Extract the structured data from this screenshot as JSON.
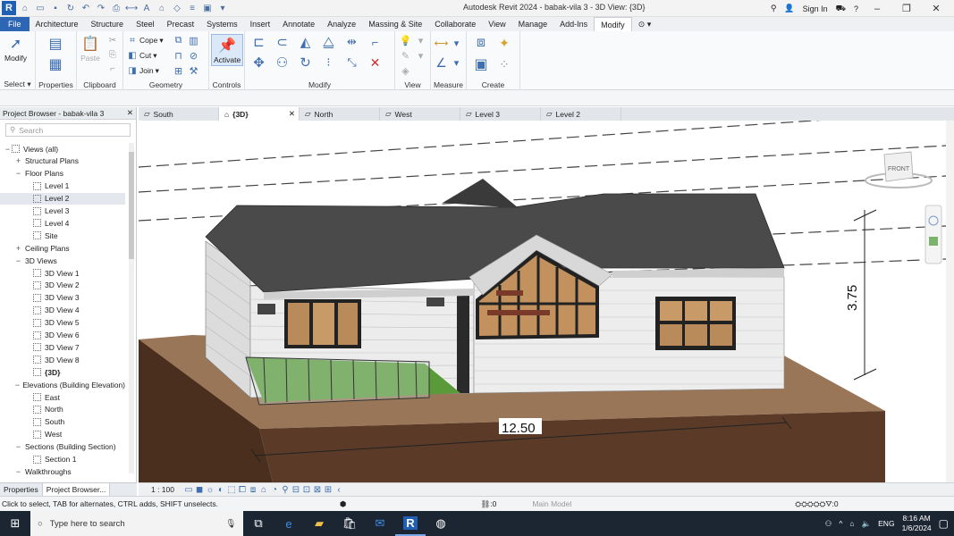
{
  "titlebar": {
    "app_title": "Autodesk Revit 2024 - babak-vila 3 - 3D View: {3D}",
    "sign_in": "Sign In",
    "help": "?"
  },
  "ribbon_tabs": [
    "File",
    "Architecture",
    "Structure",
    "Steel",
    "Precast",
    "Systems",
    "Insert",
    "Annotate",
    "Analyze",
    "Massing & Site",
    "Collaborate",
    "View",
    "Manage",
    "Add-Ins",
    "Modify"
  ],
  "active_tab": "Modify",
  "ribbon": {
    "select": {
      "modify": "Modify",
      "label": "Select ▾"
    },
    "properties": {
      "label": "Properties"
    },
    "clipboard": {
      "paste": "Paste",
      "label": "Clipboard"
    },
    "geometry": {
      "cope": "Cope",
      "cut": "Cut",
      "join": "Join",
      "label": "Geometry"
    },
    "controls": {
      "activate": "Activate",
      "label": "Controls"
    },
    "modify": {
      "label": "Modify"
    },
    "view": {
      "label": "View"
    },
    "measure": {
      "label": "Measure"
    },
    "create": {
      "label": "Create"
    }
  },
  "project_browser": {
    "title": "Project Browser - babak-vila 3",
    "search_placeholder": "Search",
    "tree": [
      {
        "label": "Views (all)",
        "level": 0,
        "toggle": "−",
        "icon": true
      },
      {
        "label": "Structural Plans",
        "level": 1,
        "toggle": "+"
      },
      {
        "label": "Floor Plans",
        "level": 1,
        "toggle": "−"
      },
      {
        "label": "Level 1",
        "level": 2,
        "icon": true
      },
      {
        "label": "Level 2",
        "level": 2,
        "icon": true,
        "selected": true
      },
      {
        "label": "Level 3",
        "level": 2,
        "icon": true
      },
      {
        "label": "Level 4",
        "level": 2,
        "icon": true
      },
      {
        "label": "Site",
        "level": 2,
        "icon": true
      },
      {
        "label": "Ceiling Plans",
        "level": 1,
        "toggle": "+"
      },
      {
        "label": "3D Views",
        "level": 1,
        "toggle": "−"
      },
      {
        "label": "3D View 1",
        "level": 2,
        "icon": true
      },
      {
        "label": "3D View 2",
        "level": 2,
        "icon": true
      },
      {
        "label": "3D View 3",
        "level": 2,
        "icon": true
      },
      {
        "label": "3D View 4",
        "level": 2,
        "icon": true
      },
      {
        "label": "3D View 5",
        "level": 2,
        "icon": true
      },
      {
        "label": "3D View 6",
        "level": 2,
        "icon": true
      },
      {
        "label": "3D View 7",
        "level": 2,
        "icon": true
      },
      {
        "label": "3D View 8",
        "level": 2,
        "icon": true
      },
      {
        "label": "{3D}",
        "level": 2,
        "icon": true,
        "bold": true
      },
      {
        "label": "Elevations (Building Elevation)",
        "level": 1,
        "toggle": "−"
      },
      {
        "label": "East",
        "level": 2,
        "icon": true
      },
      {
        "label": "North",
        "level": 2,
        "icon": true
      },
      {
        "label": "South",
        "level": 2,
        "icon": true
      },
      {
        "label": "West",
        "level": 2,
        "icon": true
      },
      {
        "label": "Sections (Building Section)",
        "level": 1,
        "toggle": "−"
      },
      {
        "label": "Section 1",
        "level": 2,
        "icon": true
      },
      {
        "label": "Walkthroughs",
        "level": 1,
        "toggle": "−"
      }
    ],
    "bottom_tabs": [
      "Properties",
      "Project Browser..."
    ]
  },
  "view_tabs": [
    {
      "label": "South",
      "active": false
    },
    {
      "label": "{3D}",
      "active": true
    },
    {
      "label": "North",
      "active": false
    },
    {
      "label": "West",
      "active": false
    },
    {
      "label": "Level 3",
      "active": false
    },
    {
      "label": "Level 2",
      "active": false
    }
  ],
  "viewport": {
    "dimension_height": "3.75",
    "dimension_width": "12.50",
    "viewcube_face": "FRONT"
  },
  "view_control": {
    "scale": "1 : 100"
  },
  "statusbar": {
    "message": "Click to select, TAB for alternates, CTRL adds, SHIFT unselects.",
    "workset_count": ":0",
    "model": "Main Model",
    "filter_count": ":0"
  },
  "taskbar": {
    "search_placeholder": "Type here to search",
    "language": "ENG",
    "time": "8:16 AM",
    "date": "1/6/2024"
  },
  "colors": {
    "file_tab": "#2c66b5",
    "roof": "#4a4a4a",
    "siding": "#e9e9e9",
    "ground_top": "#9a7658",
    "ground_side": "#5a3a26",
    "taskbar": "#1c2633"
  }
}
